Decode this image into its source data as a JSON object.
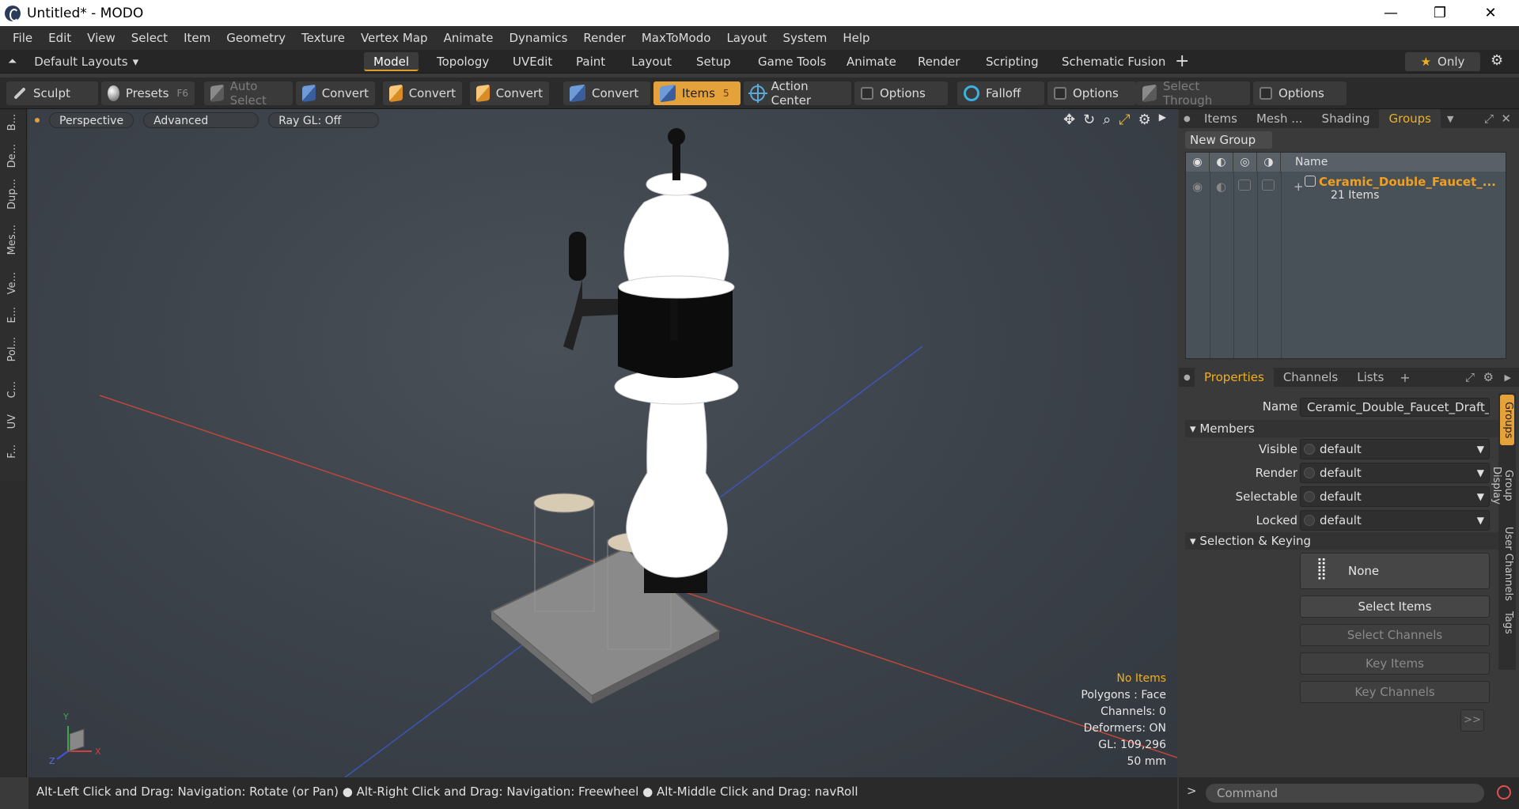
{
  "window": {
    "title": "Untitled* - MODO",
    "minimize": "—",
    "maximize": "❐",
    "close": "✕"
  },
  "menu": [
    "File",
    "Edit",
    "View",
    "Select",
    "Item",
    "Geometry",
    "Texture",
    "Vertex Map",
    "Animate",
    "Dynamics",
    "Render",
    "MaxToModo",
    "Layout",
    "System",
    "Help"
  ],
  "layouts": {
    "label": "Default Layouts",
    "caret": "▾"
  },
  "tabs": [
    "Model",
    "Topology",
    "UVEdit",
    "Paint",
    "Layout",
    "Setup",
    "Game Tools",
    "Animate",
    "Render",
    "Scripting",
    "Schematic Fusion"
  ],
  "active_tab": "Model",
  "only": {
    "star": "★",
    "label": "Only"
  },
  "toolbar": {
    "sculpt": "Sculpt",
    "presets": "Presets",
    "presets_key": "F6",
    "auto_select": "Auto Select",
    "convert1": "Convert",
    "convert2": "Convert",
    "convert3": "Convert",
    "convert4": "Convert",
    "items": "Items",
    "items_key": "5",
    "action_center": "Action Center",
    "options1": "Options",
    "falloff": "Falloff",
    "options2": "Options",
    "select_through": "Select Through",
    "options3": "Options"
  },
  "left_tools": [
    "B...",
    "De...",
    "Dup...",
    "Mes...",
    "Ve...",
    "E...",
    "Pol...",
    "C...",
    "UV",
    "F..."
  ],
  "viewport": {
    "perspective": "Perspective",
    "advanced": "Advanced",
    "raygl": "Ray GL: Off",
    "hud": {
      "items": "No Items",
      "polygons": "Polygons : Face",
      "channels": "Channels: 0",
      "deformers": "Deformers: ON",
      "gl": "GL: 109,296",
      "size": "50 mm"
    },
    "axis": {
      "x": "X",
      "y": "Y",
      "z": "Z"
    }
  },
  "groups_panel": {
    "tabs": [
      "Items",
      "Mesh ...",
      "Shading",
      "Groups"
    ],
    "active": "Groups",
    "new_group": "New Group",
    "column_name": "Name",
    "group": {
      "name": "Ceramic_Double_Faucet_...",
      "count": "21 Items"
    }
  },
  "properties_panel": {
    "tabs": [
      "Properties",
      "Channels",
      "Lists"
    ],
    "active": "Properties",
    "name_label": "Name",
    "name_value": "Ceramic_Double_Faucet_Draft_B",
    "members_header": "Members",
    "visible_label": "Visible",
    "visible_value": "default",
    "render_label": "Render",
    "render_value": "default",
    "selectable_label": "Selectable",
    "selectable_value": "default",
    "locked_label": "Locked",
    "locked_value": "default",
    "selection_header": "Selection & Keying",
    "none_btn": "None",
    "select_items": "Select Items",
    "select_channels": "Select Channels",
    "key_items": "Key Items",
    "key_channels": "Key Channels",
    "more": ">>",
    "side_tabs": [
      "Groups",
      "Group Display",
      "User Channels",
      "Tags"
    ]
  },
  "status": {
    "text1": "Alt-Left Click and Drag: Navigation: Rotate (or Pan)",
    "text2": "Alt-Right Click and Drag: Navigation: Freewheel",
    "text3": "Alt-Middle Click and Drag: navRoll"
  },
  "command": {
    "placeholder": "Command"
  },
  "colors": {
    "accent": "#e6a23a",
    "group_name": "#f0a020",
    "panel_bg": "#3a3a3a"
  }
}
